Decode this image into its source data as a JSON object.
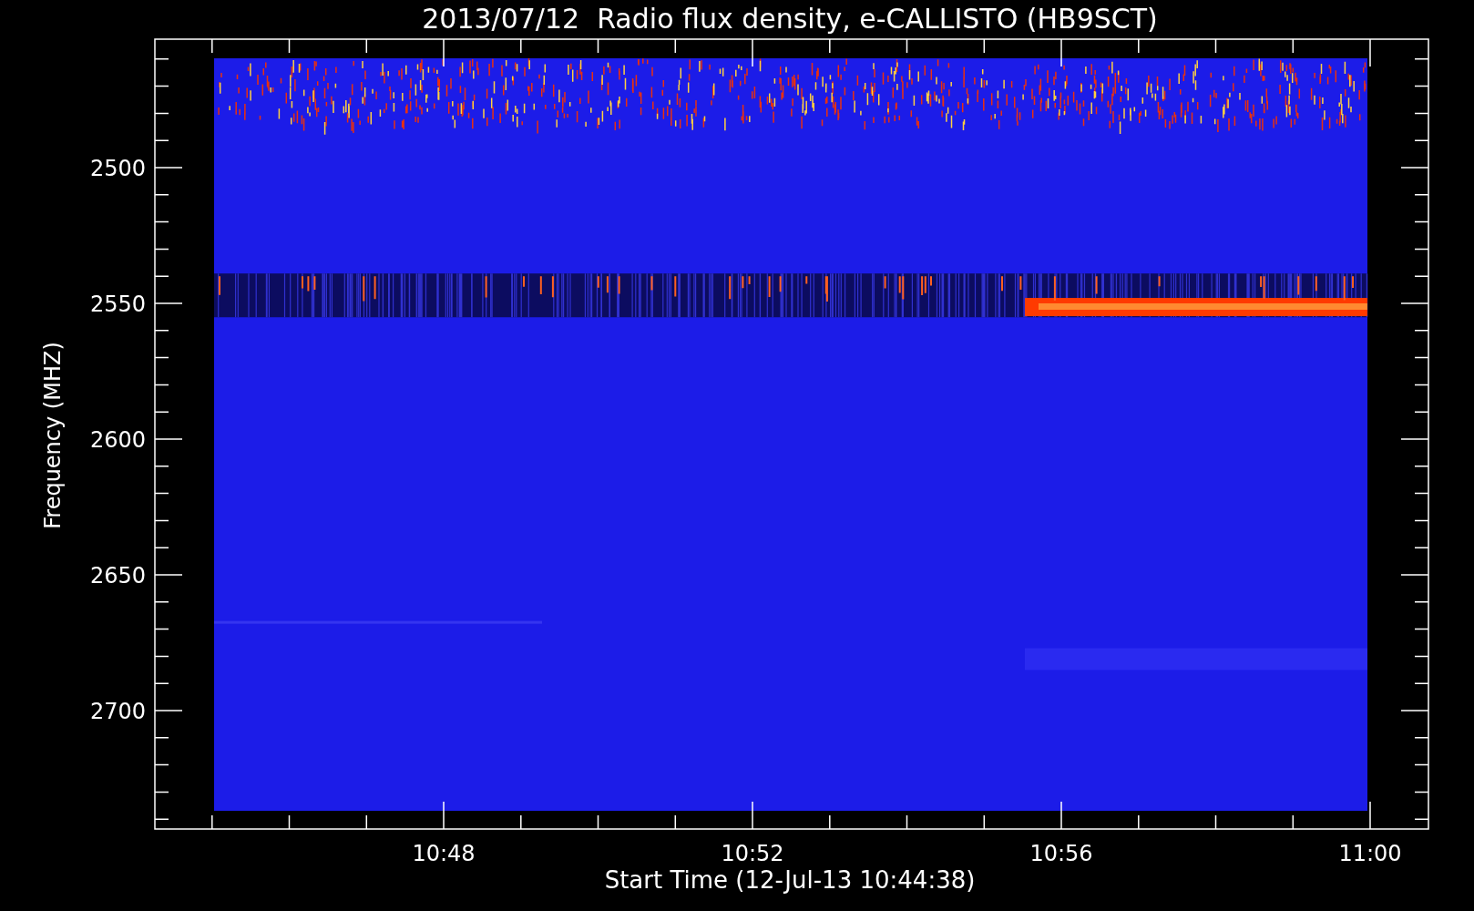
{
  "title": "2013/07/12  Radio flux density, e-CALLISTO (HB9SCT)",
  "y_axis": {
    "label": "Frequency (MHZ)",
    "tick_labels": [
      "2500",
      "2550",
      "2600",
      "2650",
      "2700"
    ]
  },
  "x_axis": {
    "label": "Start Time (12-Jul-13 10:44:38)",
    "tick_labels": [
      "10:48",
      "10:52",
      "10:56",
      "11:00"
    ]
  }
}
